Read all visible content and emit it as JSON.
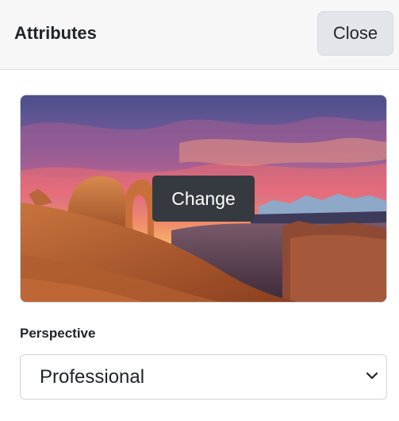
{
  "header": {
    "title": "Attributes",
    "close_label": "Close"
  },
  "image": {
    "subject": "desert-arch-sunset-photo",
    "change_label": "Change"
  },
  "perspective": {
    "label": "Perspective",
    "selected": "Professional"
  },
  "colors": {
    "header_bg": "#f7f7f7",
    "close_bg": "#e2e6ea",
    "change_bg": "#343a40",
    "border": "#ced4da"
  }
}
